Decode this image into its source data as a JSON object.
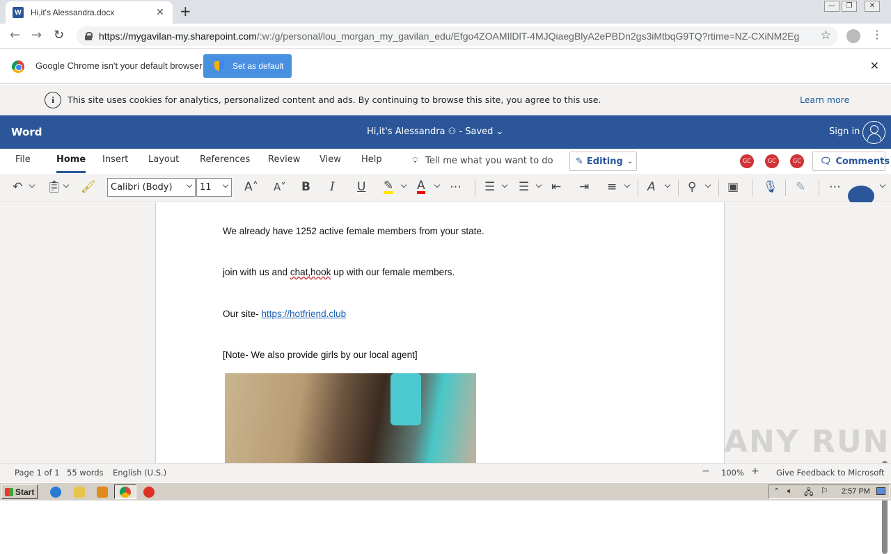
{
  "browser": {
    "tab_title": "Hi,it's Alessandra.docx",
    "tab_close": "✕",
    "new_tab": "+",
    "url_host": "https://mygavilan-my.sharepoint.com",
    "url_path": "/:w:/g/personal/lou_morgan_my_gavilan_edu/Efgo4ZOAMIlDlT-4MJQiaegBlyA2ePBDn2gs3iMtbqG9TQ?rtime=NZ-CXiNM2Eg",
    "default_msg": "Google Chrome isn't your default browser",
    "set_default": "Set as default",
    "close_infobar": "✕"
  },
  "cookie": {
    "message": "This site uses cookies for analytics, personalized content and ads. By continuing to browse this site, you agree to this use.",
    "learn_more": "Learn more"
  },
  "word": {
    "app_name": "Word",
    "doc_status": "Hi,it's Alessandra ⚇ - Saved ⌄",
    "sign_in": "Sign in",
    "tabs": [
      "File",
      "Home",
      "Insert",
      "Layout",
      "References",
      "Review",
      "View",
      "Help"
    ],
    "tell_me": "Tell me what you want to do",
    "editing": "Editing",
    "gc_label": "GC",
    "comments": "Comments",
    "font_name": "Calibri (Body)",
    "font_size": "11"
  },
  "document": {
    "p1": "We already have 1252 active female members from your state.",
    "p2_before": "join with us and ",
    "p2_squiggle": "chat,hook",
    "p2_after": " up with our female members.",
    "p3_prefix": "Our site- ",
    "p3_link": "https://hotfriend.club",
    "p4": "[Note- We also provide girls by our local agent]"
  },
  "statusbar": {
    "page": "Page 1 of 1",
    "words": "55 words",
    "language": "English (U.S.)",
    "zoom": "100%",
    "feedback": "Give Feedback to Microsoft"
  },
  "taskbar": {
    "start": "Start",
    "clock": "2:57 PM"
  },
  "watermark": "ANY RUN"
}
